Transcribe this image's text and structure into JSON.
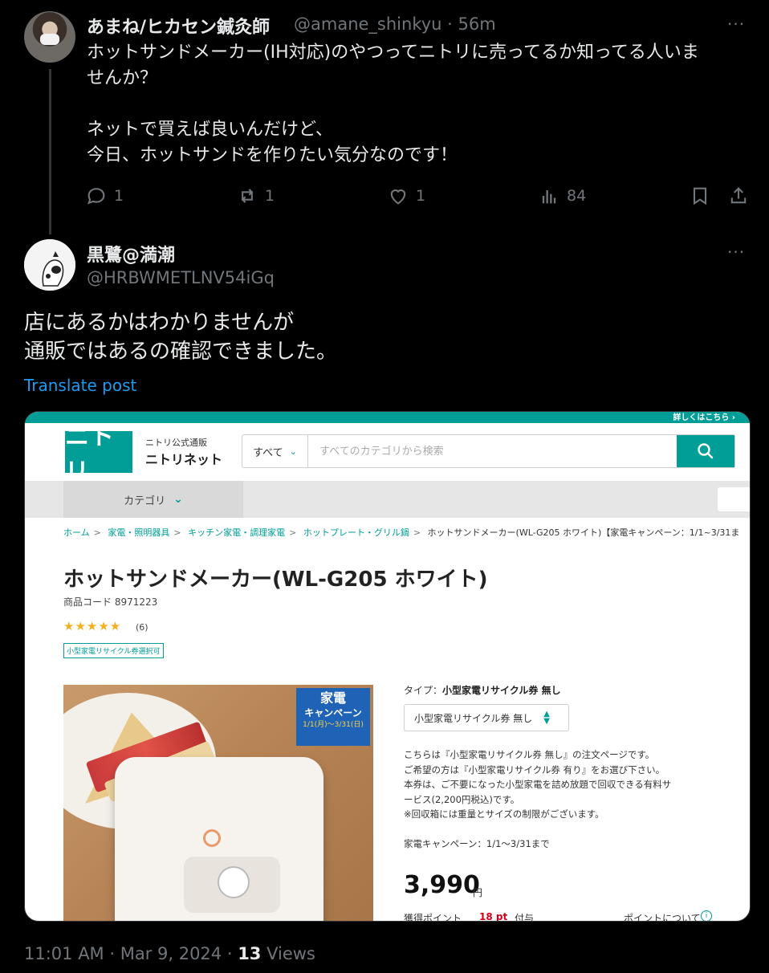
{
  "tweet": {
    "author_name": "あまね/ヒカセン鍼灸師",
    "author_handle_time": "@amane_shinkyu · 56m",
    "text": "ホットサンドメーカー(IH対応)のやつってニトリに売ってるか知ってる人いま\nせんか？\n\nネットで買えば良いんだけど、\n今日、ホットサンドを作りたい気分なのです！",
    "replies": "1",
    "reposts": "1",
    "likes": "1",
    "views": "84",
    "more": "···"
  },
  "reply": {
    "author_name": "黒鷺@満潮",
    "author_handle": "@HRBWMETLNV54iGq",
    "more": "···",
    "text": "店にあるかはわかりませんが\n通販ではあるの確認できました。",
    "translate_label": "Translate post"
  },
  "nitori": {
    "banner_right": "詳しくはこちら ›",
    "logo_text": "ニトリ",
    "logo_sub": "ニトリ公式通販",
    "logo_main": "ニトリネット",
    "search_category": "すべて",
    "search_placeholder": "すべてのカテゴリから検索",
    "category_button": "カテゴリ",
    "breadcrumbs": [
      "ホーム",
      "家電・照明器具",
      "キッチン家電・調理家電",
      "ホットプレート・グリル鍋"
    ],
    "breadcrumb_current": "ホットサンドメーカー(WL-G205 ホワイト)【家電キャンペーン：1/1~3/31ま",
    "product_title": "ホットサンドメーカー(WL-G205 ホワイト)",
    "product_code": "商品コード 8971223",
    "stars": "★★★★★",
    "review_count": "(6)",
    "recycle_tag": "小型家電リサイクル券選択可",
    "campaign_badge_line1": "家電",
    "campaign_badge_line2": "キャンペーン",
    "campaign_badge_dates": "1/1(月)～3/31(日)",
    "type_label": "タイプ：",
    "type_value": "小型家電リサイクル券 無し",
    "type_select_value": "小型家電リサイクル券 無し",
    "notes": "こちらは『小型家電リサイクル券 無し』の注文ページです。\nご希望の方は『小型家電リサイクル券 有り』をお選び下さい。\n本券は、ご不要になった小型家電を詰め放題で回収できる有料サ\nービス(2,200円税込)です。\n※回収箱には重量とサイズの制限がございます。",
    "campaign_text": "家電キャンペーン：1/1～3/31まで",
    "price": "3,990",
    "price_unit": "円",
    "points_label": "獲得ポイント",
    "points_value": "18 pt",
    "points_suffix": "付与",
    "points_about": "ポイントについて",
    "rating": 4.5,
    "brand_color": "#009e96"
  },
  "footer": {
    "time": "11:01 AM · Mar 9, 2024 · ",
    "views_count": "13",
    "views_label": " Views"
  }
}
